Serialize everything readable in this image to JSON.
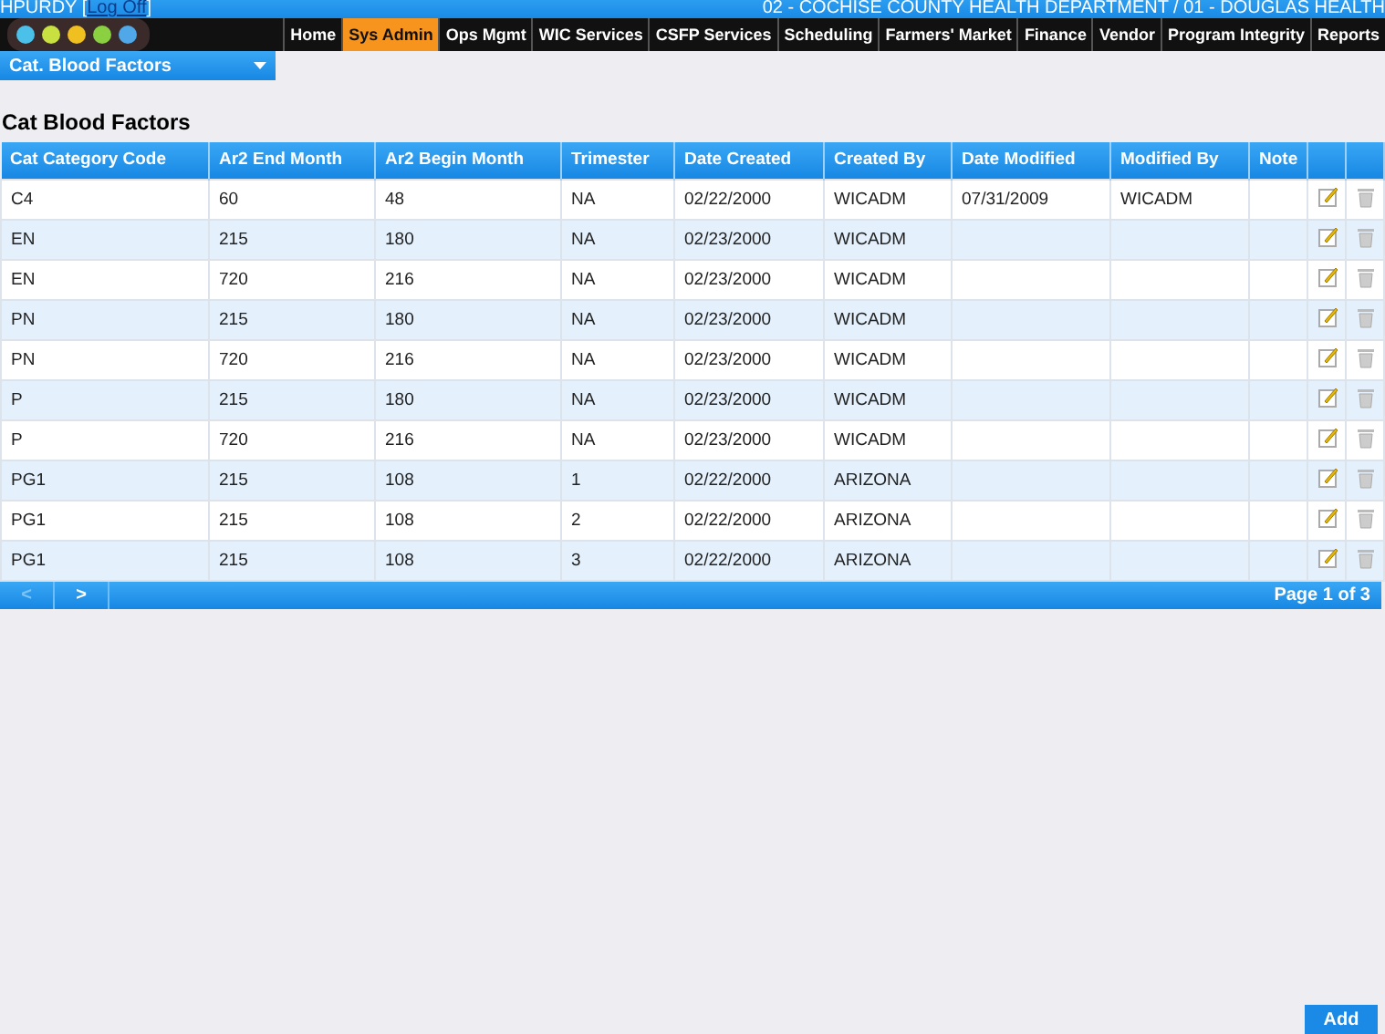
{
  "user": {
    "name": "HPURDY",
    "open_bracket": "[",
    "logout": "Log Off",
    "close_bracket": "]"
  },
  "agency": "02 - COCHISE COUNTY HEALTH DEPARTMENT / 01 - DOUGLAS HEALTH",
  "nav": [
    {
      "label": "Home",
      "selected": false
    },
    {
      "label": "Sys Admin",
      "selected": true
    },
    {
      "label": "Ops Mgmt",
      "selected": false
    },
    {
      "label": "WIC Services",
      "selected": false
    },
    {
      "label": "CSFP Services",
      "selected": false
    },
    {
      "label": "Scheduling",
      "selected": false
    },
    {
      "label": "Farmers' Market",
      "selected": false
    },
    {
      "label": "Finance",
      "selected": false
    },
    {
      "label": "Vendor",
      "selected": false
    },
    {
      "label": "Program Integrity",
      "selected": false
    },
    {
      "label": "Reports",
      "selected": false
    }
  ],
  "page_select": {
    "value": "Cat. Blood Factors"
  },
  "title": "Cat Blood Factors",
  "table": {
    "columns": [
      "Cat Category Code",
      "Ar2 End Month",
      "Ar2 Begin Month",
      "Trimester",
      "Date Created",
      "Created By",
      "Date Modified",
      "Modified By",
      "Note"
    ],
    "rows": [
      [
        "C4",
        "60",
        "48",
        "NA",
        "02/22/2000",
        "WICADM",
        "07/31/2009",
        "WICADM",
        ""
      ],
      [
        "EN",
        "215",
        "180",
        "NA",
        "02/23/2000",
        "WICADM",
        "",
        "",
        ""
      ],
      [
        "EN",
        "720",
        "216",
        "NA",
        "02/23/2000",
        "WICADM",
        "",
        "",
        ""
      ],
      [
        "PN",
        "215",
        "180",
        "NA",
        "02/23/2000",
        "WICADM",
        "",
        "",
        ""
      ],
      [
        "PN",
        "720",
        "216",
        "NA",
        "02/23/2000",
        "WICADM",
        "",
        "",
        ""
      ],
      [
        "P",
        "215",
        "180",
        "NA",
        "02/23/2000",
        "WICADM",
        "",
        "",
        ""
      ],
      [
        "P",
        "720",
        "216",
        "NA",
        "02/23/2000",
        "WICADM",
        "",
        "",
        ""
      ],
      [
        "PG1",
        "215",
        "108",
        "1",
        "02/22/2000",
        "ARIZONA",
        "",
        "",
        ""
      ],
      [
        "PG1",
        "215",
        "108",
        "2",
        "02/22/2000",
        "ARIZONA",
        "",
        "",
        ""
      ],
      [
        "PG1",
        "215",
        "108",
        "3",
        "02/22/2000",
        "ARIZONA",
        "",
        "",
        ""
      ]
    ]
  },
  "pager": {
    "prev": {
      "label": "<",
      "disabled": true
    },
    "next": {
      "label": ">",
      "disabled": false
    },
    "info": "Page 1 of 3"
  },
  "add_button": "Add"
}
